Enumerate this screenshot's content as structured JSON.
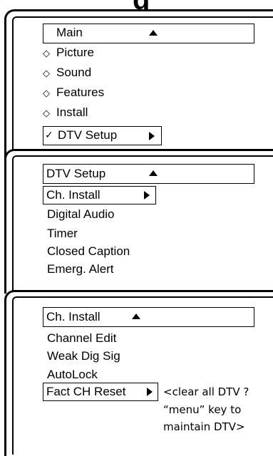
{
  "top_title_fragment": "g",
  "panel1": {
    "title": "Main",
    "items": [
      "Picture",
      "Sound",
      "Features",
      "Install"
    ],
    "selected": "DTV Setup",
    "check_mark": "✓",
    "bullet": "◇"
  },
  "panel2": {
    "title": "DTV Setup",
    "selected": "Ch. Install",
    "items": [
      "Digital Audio",
      "Timer",
      "Closed Caption",
      "Emerg. Alert"
    ]
  },
  "panel3": {
    "title": "Ch. Install",
    "items": [
      "Channel Edit",
      "Weak Dig Sig",
      "AutoLock"
    ],
    "selected": "Fact CH Reset",
    "note_lines": [
      "<clear all DTV ?",
      "“menu” key to",
      "maintain DTV>"
    ]
  }
}
